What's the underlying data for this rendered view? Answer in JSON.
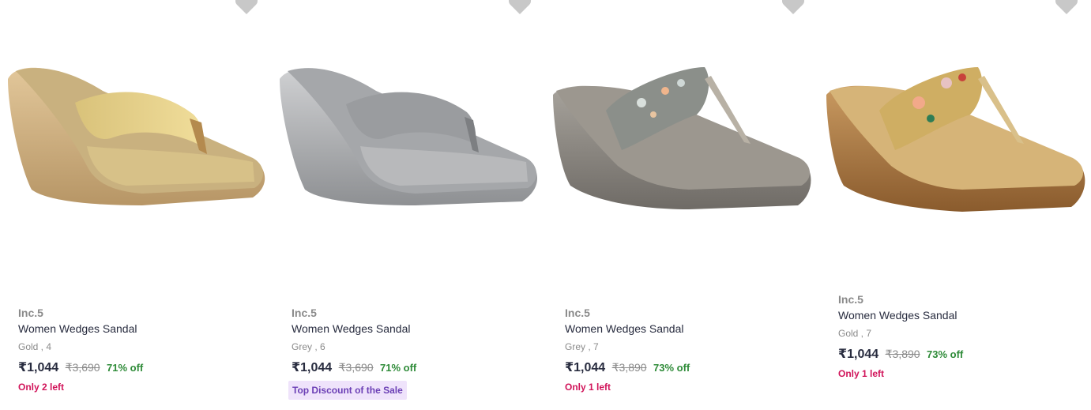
{
  "products": [
    {
      "brand": "Inc.5",
      "name": "Women Wedges Sandal",
      "variant": "Gold , 4",
      "price": "₹1,044",
      "mrp": "₹3,690",
      "discount": "71% off",
      "stock": "Only 2 left",
      "tag": "",
      "image_icon": "gold-glitter-wedge-sandal"
    },
    {
      "brand": "Inc.5",
      "name": "Women Wedges Sandal",
      "variant": "Grey , 6",
      "price": "₹1,044",
      "mrp": "₹3,690",
      "discount": "71% off",
      "stock": "",
      "tag": "Top Discount of the Sale",
      "image_icon": "grey-rhinestone-wedge-sandal"
    },
    {
      "brand": "Inc.5",
      "name": "Women Wedges Sandal",
      "variant": "Grey , 7",
      "price": "₹1,044",
      "mrp": "₹3,890",
      "discount": "73% off",
      "stock": "Only 1 left",
      "tag": "",
      "image_icon": "pewter-embellished-wedge-sandal"
    },
    {
      "brand": "Inc.5",
      "name": "Women Wedges Sandal",
      "variant": "Gold , 7",
      "price": "₹1,044",
      "mrp": "₹3,890",
      "discount": "73% off",
      "stock": "Only 1 left",
      "tag": "",
      "image_icon": "bronze-floral-wedge-sandal"
    }
  ],
  "colors": {
    "discount": "#2e8b38",
    "stock": "#d1145a",
    "tag_bg": "#efe3fb",
    "tag_text": "#6b3fb5",
    "wishlist_icon": "#c8c8c8"
  },
  "wishlist_icon": "heart-icon"
}
